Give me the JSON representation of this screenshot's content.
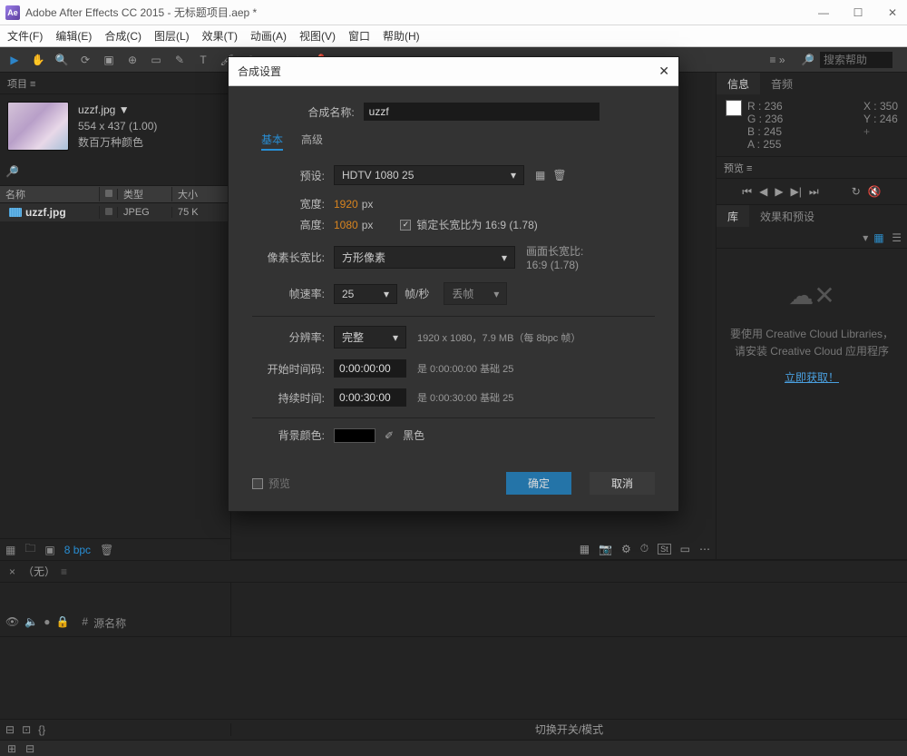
{
  "window": {
    "title": "Adobe After Effects CC 2015 - 无标题项目.aep *"
  },
  "menubar": [
    "文件(F)",
    "编辑(E)",
    "合成(C)",
    "图层(L)",
    "效果(T)",
    "动画(A)",
    "视图(V)",
    "窗口",
    "帮助(H)"
  ],
  "search_placeholder": "搜索帮助",
  "project": {
    "panel_label": "项目 ≡",
    "item_name": "uzzf.jpg ▼",
    "dims": "554 x 437 (1.00)",
    "desc": "数百万种颜色",
    "cols": {
      "name": "名称",
      "type": "类型",
      "size": "大小"
    },
    "row": {
      "name": "uzzf.jpg",
      "type": "JPEG",
      "size": "75 K"
    },
    "bpc": "8 bpc"
  },
  "timeline": {
    "tab": "（无）",
    "cols_label": "源名称",
    "footer": "切换开关/模式"
  },
  "right": {
    "tabs": {
      "info": "信息",
      "audio": "音频"
    },
    "rgb": {
      "r": "R : 236",
      "g": "G : 236",
      "b": "B : 245",
      "a": "A : 255"
    },
    "xy": {
      "x": "X : 350",
      "y": "Y : 246"
    },
    "preview": "预览 ≡",
    "lib_tabs": {
      "lib": "库",
      "effects": "效果和预设"
    },
    "lib_msg1": "要使用 Creative Cloud Libraries，",
    "lib_msg2": "请安装 Creative Cloud 应用程序",
    "lib_link": "立即获取！"
  },
  "dialog": {
    "title": "合成设置",
    "name_label": "合成名称:",
    "name_value": "uzzf",
    "tab_basic": "基本",
    "tab_adv": "高级",
    "preset_label": "预设:",
    "preset_value": "HDTV 1080 25",
    "width_label": "宽度:",
    "width_value": "1920",
    "px": "px",
    "height_label": "高度:",
    "height_value": "1080",
    "lock_label": "锁定长宽比为 16:9 (1.78)",
    "par_label": "像素长宽比:",
    "par_value": "方形像素",
    "par_aside1": "画面长宽比:",
    "par_aside2": "16:9 (1.78)",
    "fps_label": "帧速率:",
    "fps_value": "25",
    "fps_unit": "帧/秒",
    "drop": "丢帧",
    "res_label": "分辨率:",
    "res_value": "完整",
    "res_aside": "1920 x 1080，7.9 MB（每 8bpc 帧）",
    "start_label": "开始时间码:",
    "start_value": "0:00:00:00",
    "start_aside": "是 0:00:00:00 基础 25",
    "dur_label": "持续时间:",
    "dur_value": "0:00:30:00",
    "dur_aside": "是 0:00:30:00 基础 25",
    "bg_label": "背景颜色:",
    "bg_text": "黑色",
    "preview_chk": "预览",
    "ok": "确定",
    "cancel": "取消"
  }
}
